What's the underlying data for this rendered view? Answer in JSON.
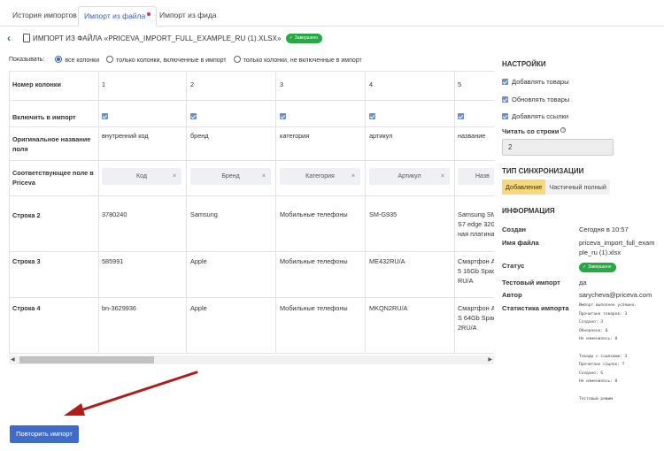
{
  "tabs": [
    {
      "label": "История импортов"
    },
    {
      "label": "Импорт из файла"
    },
    {
      "label": "Импорт из фида"
    }
  ],
  "header": {
    "title": "ИМПОРТ ИЗ ФАЙЛА «PRICEVA_IMPORT_FULL_EXAMPLE_RU (1).XLSX»",
    "badge": "Завершено"
  },
  "show": {
    "label": "Показывать:",
    "options": [
      "все колонки",
      "только колонки, включенные в импорт",
      "только колонки, не включенные в импорт"
    ],
    "selected": "все колонки"
  },
  "table": {
    "row_headers": [
      "Номер колонки",
      "Включить в импорт",
      "Оригинальное название поля",
      "Соответствующее поле в Priceva",
      "Строка 2",
      "Строка 3",
      "Строка 4"
    ],
    "columns": [
      {
        "num": "1",
        "original": "внутренний код",
        "mapped": "Код",
        "r2": "3780240",
        "r3": "585991",
        "r4": "bn-3629936"
      },
      {
        "num": "2",
        "original": "бренд",
        "mapped": "Бренд",
        "r2": "Samsung",
        "r3": "Apple",
        "r4": "Apple"
      },
      {
        "num": "3",
        "original": "категория",
        "mapped": "Категория",
        "r2": "Мобильные телефоны",
        "r3": "Мобильные телефоны",
        "r4": "Мобильные телефоны"
      },
      {
        "num": "4",
        "original": "артикул",
        "mapped": "Артикул",
        "r2": "SM-G935",
        "r3": "ME432RU/A",
        "r4": "MKQN2RU/A"
      },
      {
        "num": "5",
        "original": "название",
        "mapped": "Назв",
        "r2": [
          "Samsung SM",
          "S7 edge 32G",
          "ная платина"
        ],
        "r3": [
          "Смартфон A",
          "5 16Gb Spac",
          "RU/A"
        ],
        "r4": [
          "Смартфон A",
          "S 64Gb Spac",
          "2RU/A"
        ]
      }
    ]
  },
  "settings": {
    "title": "НАСТРОЙКИ",
    "checkboxes": [
      "Добавлять товары",
      "Обновлять товары",
      "Добавлять ссылки"
    ],
    "read_from_label": "Читать со строки",
    "read_from_value": "2",
    "sync_title": "ТИП СИНХРОНИЗАЦИИ",
    "sync_options": [
      "Добавление",
      "Частичный полный"
    ],
    "sync_selected": "Добавление"
  },
  "info": {
    "title": "ИНФОРМАЦИЯ",
    "created_label": "Создан",
    "created_value": "Сегодня в 10:57",
    "filename_label": "Имя файла",
    "filename_value": [
      "priceva_import_full_exam",
      "ple_ru (1).xlsx"
    ],
    "status_label": "Статус",
    "status_value": "Завершено",
    "test_label": "Тестовый импорт",
    "test_value": "да",
    "author_label": "Автор",
    "author_value": "sarycheva@priceva.com",
    "stats_label": "Статистика импорта",
    "stats_lines": [
      "Импорт выполнен успешно.",
      "Прочитано товаров: 3",
      "Создано: 3",
      "Обновлено: 0",
      "Не изменилось: 0",
      "",
      "Товары с ссылками: 3",
      "Прочитано ссылок: 7",
      "Создано: 6",
      "Не изменилось: 0",
      "",
      "Тестовый режим"
    ]
  },
  "actions": {
    "repeat_label": "Повторить импорт"
  },
  "colors": {
    "accent": "#3a63b8",
    "success": "#28a745",
    "arrow": "#b01c1c",
    "segment_active": "#f7d87a"
  }
}
